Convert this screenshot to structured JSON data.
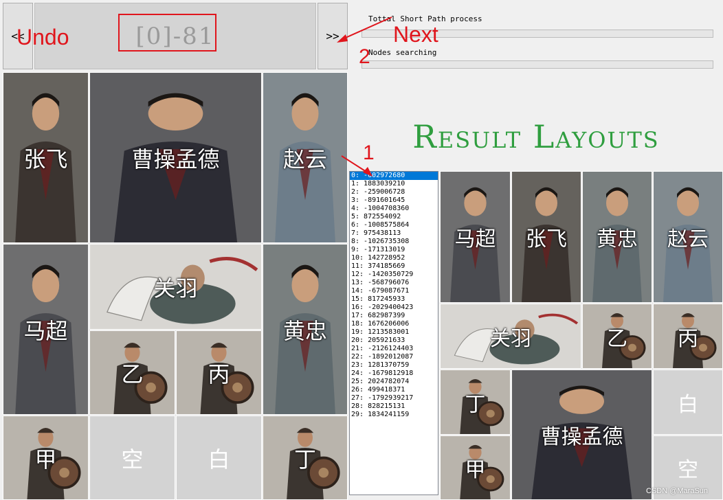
{
  "nav": {
    "prev_label": "<<",
    "next_label": ">>",
    "counter": "[0]-81"
  },
  "annotations": {
    "undo": "Undo",
    "next": "Next",
    "num1": "1",
    "num2": "2"
  },
  "progress": {
    "total_label": "Tottal Short Path process",
    "total_value": 0,
    "nodes_label": "Nodes searching",
    "nodes_value": 0
  },
  "result_title": "Result Layouts",
  "list": {
    "selected_index": 0,
    "items": [
      "0: -602972680",
      "1: 1883039210",
      "2: -259006728",
      "3: -891601645",
      "4: -1004708360",
      "5: 872554092",
      "6: -1008575864",
      "7: 975438113",
      "8: -1026735308",
      "9: -171313019",
      "10: 142728952",
      "11: 374185669",
      "12: -1420350729",
      "13: -568796076",
      "14: -679087671",
      "15: 817245933",
      "16: -2029400423",
      "17: 682987399",
      "18: 1676206006",
      "19: 1213583001",
      "20: 205921633",
      "21: -2126124403",
      "22: -1892012087",
      "23: 1281370759",
      "24: -1679812918",
      "25: 2024782074",
      "26: 499418371",
      "27: -1792939217",
      "28: 828215131",
      "29: 1834241159"
    ]
  },
  "left_board": [
    {
      "name": "张飞",
      "kind": "general",
      "color": "#3b3430"
    },
    {
      "name": "曹操孟德",
      "kind": "general",
      "color": "#2c2c34"
    },
    {
      "name": "赵云",
      "kind": "general",
      "color": "#6d7d8a"
    },
    {
      "name": "马超",
      "kind": "general",
      "color": "#4a4b50"
    },
    {
      "name": "关羽",
      "kind": "horse",
      "color": "#b9b6b0"
    },
    {
      "name": "黄忠",
      "kind": "general",
      "color": "#5f6a6e"
    },
    {
      "name": "乙",
      "kind": "soldier",
      "color": "#3b3530"
    },
    {
      "name": "丙",
      "kind": "soldier",
      "color": "#3b3530"
    },
    {
      "name": "甲",
      "kind": "soldier",
      "color": "#3b3530"
    },
    {
      "name": "空",
      "kind": "empty",
      "color": "#d3d3d3"
    },
    {
      "name": "白",
      "kind": "empty",
      "color": "#d3d3d3"
    },
    {
      "name": "丁",
      "kind": "soldier",
      "color": "#3b3530"
    }
  ],
  "right_board": [
    {
      "name": "马超",
      "kind": "general",
      "color": "#4a4b50"
    },
    {
      "name": "张飞",
      "kind": "general",
      "color": "#3b3430"
    },
    {
      "name": "黄忠",
      "kind": "general",
      "color": "#5f6a6e"
    },
    {
      "name": "赵云",
      "kind": "general",
      "color": "#6d7d8a"
    },
    {
      "name": "关羽",
      "kind": "horse",
      "color": "#b9b6b0"
    },
    {
      "name": "乙",
      "kind": "soldier",
      "color": "#3b3530"
    },
    {
      "name": "丙",
      "kind": "soldier",
      "color": "#3b3530"
    },
    {
      "name": "丁",
      "kind": "soldier",
      "color": "#3b3530"
    },
    {
      "name": "曹操孟德",
      "kind": "general",
      "color": "#2c2c34"
    },
    {
      "name": "白",
      "kind": "empty",
      "color": "#d3d3d3"
    },
    {
      "name": "甲",
      "kind": "soldier",
      "color": "#3b3530"
    },
    {
      "name": "空",
      "kind": "empty",
      "color": "#d3d3d3"
    }
  ],
  "watermark": "CSDN @MaraSun",
  "colors": {
    "annotation": "#e0151c",
    "title": "#2f9e3f",
    "selection": "#0078d7"
  }
}
